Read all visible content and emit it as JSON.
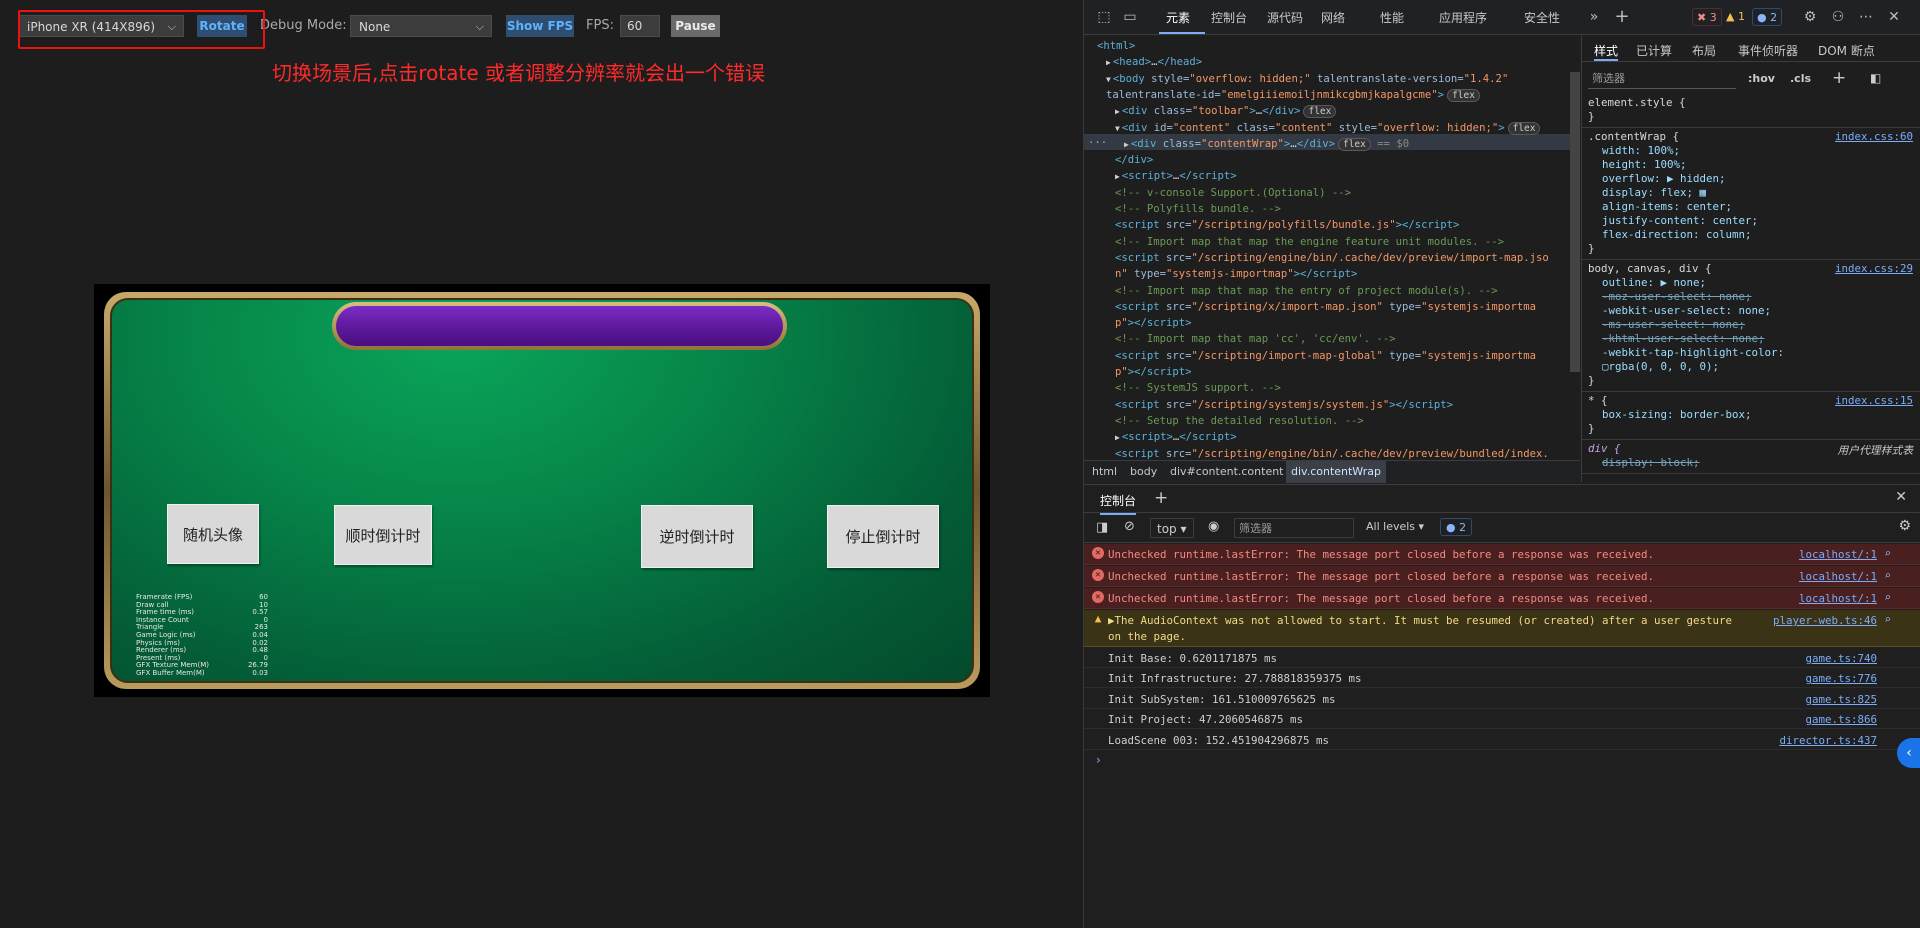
{
  "preview": {
    "toolbar": {
      "device": "iPhone XR (414X896)",
      "rotate": "Rotate",
      "debug_mode_label": "Debug Mode:",
      "debug_mode_value": "None",
      "show_fps": "Show FPS",
      "fps_label": "FPS:",
      "fps_value": "60",
      "pause": "Pause"
    },
    "annotation": "切换场景后,点击rotate 或者调整分辨率就会出一个错误",
    "game": {
      "buttons": [
        "随机头像",
        "顺时倒计时",
        "逆时倒计时",
        "停止倒计时"
      ],
      "stats": [
        {
          "label": "Framerate (FPS)",
          "value": "60"
        },
        {
          "label": "Draw call",
          "value": "10"
        },
        {
          "label": "Frame time (ms)",
          "value": "0.57"
        },
        {
          "label": "Instance Count",
          "value": "0"
        },
        {
          "label": "Triangle",
          "value": "263"
        },
        {
          "label": "Game Logic (ms)",
          "value": "0.04"
        },
        {
          "label": "Physics (ms)",
          "value": "0.02"
        },
        {
          "label": "Renderer (ms)",
          "value": "0.48"
        },
        {
          "label": "Present (ms)",
          "value": "0"
        },
        {
          "label": "GFX Texture Mem(M)",
          "value": "26.79"
        },
        {
          "label": "GFX Buffer Mem(M)",
          "value": "0.03"
        }
      ]
    }
  },
  "devtools": {
    "tabs": [
      "元素",
      "控制台",
      "源代码",
      "网络",
      "性能",
      "应用程序",
      "安全性"
    ],
    "badges": {
      "errors": "3",
      "warnings": "1",
      "messages": "2"
    },
    "dom": [
      {
        "indent": 1,
        "arrow": "",
        "html": "<span class='tag'>&lt;html&gt;</span>"
      },
      {
        "indent": 2,
        "arrow": "▶",
        "html": "<span class='tag'>&lt;head&gt;</span><span class='txt'>…</span><span class='tag'>&lt;/head&gt;</span>"
      },
      {
        "indent": 2,
        "arrow": "▼",
        "html": "<span class='tag'>&lt;body </span><span class='attr'>style=</span><span class='val'>\"overflow: hidden;\"</span> <span class='attr'>talentranslate-version=</span><span class='val'>\"1.4.2\"</span>"
      },
      {
        "indent": 2,
        "arrow": "",
        "html": "<span class='attr'>talentranslate-id=</span><span class='val'>\"emelgiiiemoiljnmikcgbmjkapalgcme\"</span><span class='tag'>&gt;</span><span class='flexpill'>flex</span>"
      },
      {
        "indent": 3,
        "arrow": "▶",
        "html": "<span class='tag'>&lt;div </span><span class='attr'>class=</span><span class='val'>\"toolbar\"</span><span class='tag'>&gt;</span><span class='txt'>…</span><span class='tag'>&lt;/div&gt;</span><span class='flexpill'>flex</span>"
      },
      {
        "indent": 3,
        "arrow": "▼",
        "html": "<span class='tag'>&lt;div </span><span class='attr'>id=</span><span class='val'>\"content\"</span> <span class='attr'>class=</span><span class='val'>\"content\"</span> <span class='attr'>style=</span><span class='val'>\"overflow: hidden;\"</span><span class='tag'>&gt;</span><span class='flexpill'>flex</span>"
      },
      {
        "indent": 4,
        "arrow": "▶",
        "html": "<span class='tag'>&lt;div </span><span class='attr'>class=</span><span class='val'>\"contentWrap\"</span><span class='tag'>&gt;</span><span class='txt'>…</span><span class='tag'>&lt;/div&gt;</span><span class='flexpill'>flex</span><span class='txt' style='color:#888'> == $0</span>"
      },
      {
        "indent": 3,
        "arrow": "",
        "html": "<span class='tag'>&lt;/div&gt;</span>"
      },
      {
        "indent": 3,
        "arrow": "▶",
        "html": "<span class='tag'>&lt;script&gt;</span><span class='txt'>…</span><span class='tag'>&lt;/script&gt;</span>"
      },
      {
        "indent": 3,
        "arrow": "",
        "html": "<span class='cmt'>&lt;!-- v-console Support.(Optional) --&gt;</span>"
      },
      {
        "indent": 3,
        "arrow": "",
        "html": "<span class='cmt'>&lt;!-- Polyfills bundle. --&gt;</span>"
      },
      {
        "indent": 3,
        "arrow": "",
        "html": "<span class='tag'>&lt;script </span><span class='attr'>src=</span><span class='val'>\"/scripting/polyfills/bundle.js\"</span><span class='tag'>&gt;&lt;/script&gt;</span>"
      },
      {
        "indent": 3,
        "arrow": "",
        "html": "<span class='cmt'>&lt;!-- Import map that map the engine feature unit modules. --&gt;</span>"
      },
      {
        "indent": 3,
        "arrow": "",
        "html": "<span class='tag'>&lt;script </span><span class='attr'>src=</span><span class='val'>\"/scripting/engine/bin/.cache/dev/preview/import-map.jso</span>"
      },
      {
        "indent": 3,
        "arrow": "",
        "html": "<span class='val'>n\"</span> <span class='attr'>type=</span><span class='val'>\"systemjs-importmap\"</span><span class='tag'>&gt;&lt;/script&gt;</span>"
      },
      {
        "indent": 3,
        "arrow": "",
        "html": "<span class='cmt'>&lt;!-- Import map that map the entry of project module(s). --&gt;</span>"
      },
      {
        "indent": 3,
        "arrow": "",
        "html": "<span class='tag'>&lt;script </span><span class='attr'>src=</span><span class='val'>\"/scripting/x/import-map.json\"</span> <span class='attr'>type=</span><span class='val'>\"systemjs-importma</span>"
      },
      {
        "indent": 3,
        "arrow": "",
        "html": "<span class='val'>p\"</span><span class='tag'>&gt;&lt;/script&gt;</span>"
      },
      {
        "indent": 3,
        "arrow": "",
        "html": "<span class='cmt'>&lt;!-- Import map that map 'cc', 'cc/env'. --&gt;</span>"
      },
      {
        "indent": 3,
        "arrow": "",
        "html": "<span class='tag'>&lt;script </span><span class='attr'>src=</span><span class='val'>\"/scripting/import-map-global\"</span> <span class='attr'>type=</span><span class='val'>\"systemjs-importma</span>"
      },
      {
        "indent": 3,
        "arrow": "",
        "html": "<span class='val'>p\"</span><span class='tag'>&gt;&lt;/script&gt;</span>"
      },
      {
        "indent": 3,
        "arrow": "",
        "html": "<span class='cmt'>&lt;!-- SystemJS support. --&gt;</span>"
      },
      {
        "indent": 3,
        "arrow": "",
        "html": "<span class='tag'>&lt;script </span><span class='attr'>src=</span><span class='val'>\"/scripting/systemjs/system.js\"</span><span class='tag'>&gt;&lt;/script&gt;</span>"
      },
      {
        "indent": 3,
        "arrow": "",
        "html": "<span class='cmt'>&lt;!-- Setup the detailed resolution. --&gt;</span>"
      },
      {
        "indent": 3,
        "arrow": "▶",
        "html": "<span class='tag'>&lt;script&gt;</span><span class='txt'>…</span><span class='tag'>&lt;/script&gt;</span>"
      },
      {
        "indent": 3,
        "arrow": "",
        "html": "<span class='tag'>&lt;script </span><span class='attr'>src=</span><span class='val'>\"/scripting/engine/bin/.cache/dev/preview/bundled/index.</span>"
      }
    ],
    "breadcrumbs": [
      "html",
      "body",
      "div#content.content",
      "div.contentWrap"
    ],
    "styles": {
      "tabs": [
        "样式",
        "已计算",
        "布局",
        "事件侦听器",
        "DOM 断点"
      ],
      "filter_placeholder": "筛选器",
      "hov": ":hov",
      "cls": ".cls",
      "blocks": [
        {
          "selector": "element.style {",
          "link": "",
          "props": [],
          "close": "}"
        },
        {
          "selector": ".contentWrap {",
          "link": "index.css:60",
          "props": [
            "width: 100%;",
            "height: 100%;",
            "overflow: ▶ hidden;",
            "display: flex; ▦",
            "align-items: center;",
            "justify-content: center;",
            "flex-direction: column;"
          ],
          "close": "}"
        },
        {
          "selector": "body, canvas, div {",
          "link": "index.css:29",
          "props": [
            "outline: ▶ none;",
            "~-moz-user-select: none;",
            "-webkit-user-select: none;",
            "~-ms-user-select: none;",
            "~-khtml-user-select: none;",
            "-webkit-tap-highlight-color:",
            "  ▢rgba(0, 0, 0, 0);"
          ],
          "close": "}"
        },
        {
          "selector": "* {",
          "link": "index.css:15",
          "props": [
            "box-sizing: border-box;"
          ],
          "close": "}"
        },
        {
          "selector": "div {",
          "link": "用户代理样式表",
          "props": [
            "~display: block;"
          ],
          "close": ""
        }
      ]
    },
    "console": {
      "tab": "控制台",
      "context": "top",
      "filter_placeholder": "筛选器",
      "levels": "All levels",
      "issues": "2",
      "messages": [
        {
          "type": "error",
          "text": "Unchecked runtime.lastError: The message port closed before a response was received.",
          "src": "localhost/:1"
        },
        {
          "type": "error",
          "text": "Unchecked runtime.lastError: The message port closed before a response was received.",
          "src": "localhost/:1"
        },
        {
          "type": "error",
          "text": "Unchecked runtime.lastError: The message port closed before a response was received.",
          "src": "localhost/:1"
        },
        {
          "type": "warn",
          "text": "▶The AudioContext was not allowed to start. It must be resumed (or created) after a user gesture",
          "text2": "on the page.",
          "src": "player-web.ts:46"
        },
        {
          "type": "log",
          "text": "Init Base: 0.6201171875 ms",
          "src": "game.ts:740"
        },
        {
          "type": "log",
          "text": "Init Infrastructure: 27.788818359375 ms",
          "src": "game.ts:776"
        },
        {
          "type": "log",
          "text": "Init SubSystem: 161.510009765625 ms",
          "src": "game.ts:825"
        },
        {
          "type": "log",
          "text": "Init Project: 47.2060546875 ms",
          "src": "game.ts:866"
        },
        {
          "type": "log",
          "text": "LoadScene 003: 152.451904296875 ms",
          "src": "director.ts:437"
        }
      ]
    }
  }
}
